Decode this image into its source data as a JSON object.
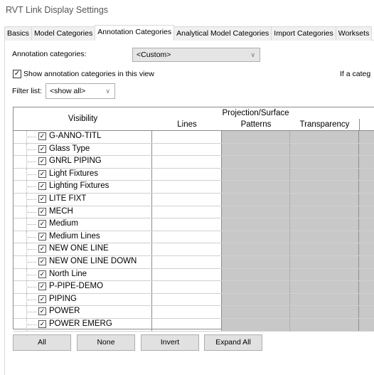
{
  "window": {
    "title": "RVT Link Display Settings"
  },
  "tabs": [
    "Basics",
    "Model Categories",
    "Annotation Categories",
    "Analytical Model Categories",
    "Import Categories",
    "Worksets"
  ],
  "active_tab": "Annotation Categories",
  "annotation_categories": {
    "label": "Annotation categories:",
    "value": "<Custom>"
  },
  "show_checkbox": {
    "label": "Show annotation categories in this view",
    "checked": true
  },
  "hint_text": "If a categ",
  "filter": {
    "label": "Filter list:",
    "value": "<show all>"
  },
  "table": {
    "headers": {
      "visibility": "Visibility",
      "group": "Projection/Surface",
      "lines": "Lines",
      "patterns": "Patterns",
      "transparency": "Transparency"
    },
    "rows": [
      {
        "name": "G-ANNO-TITL",
        "checked": true
      },
      {
        "name": "Glass Type",
        "checked": true
      },
      {
        "name": "GNRL PIPING",
        "checked": true
      },
      {
        "name": "Light Fixtures",
        "checked": true
      },
      {
        "name": "Lighting Fixtures",
        "checked": true
      },
      {
        "name": "LITE FIXT",
        "checked": true
      },
      {
        "name": "MECH",
        "checked": true
      },
      {
        "name": "Medium",
        "checked": true
      },
      {
        "name": "Medium Lines",
        "checked": true
      },
      {
        "name": "NEW ONE LINE",
        "checked": true
      },
      {
        "name": "NEW ONE LINE DOWN",
        "checked": true
      },
      {
        "name": "North Line",
        "checked": true
      },
      {
        "name": "P-PIPE-DEMO",
        "checked": true
      },
      {
        "name": "PIPING",
        "checked": true
      },
      {
        "name": "POWER",
        "checked": true
      },
      {
        "name": "POWER EMERG",
        "checked": true
      }
    ]
  },
  "buttons": {
    "all": "All",
    "none": "None",
    "invert": "Invert",
    "expand_all": "Expand All"
  }
}
